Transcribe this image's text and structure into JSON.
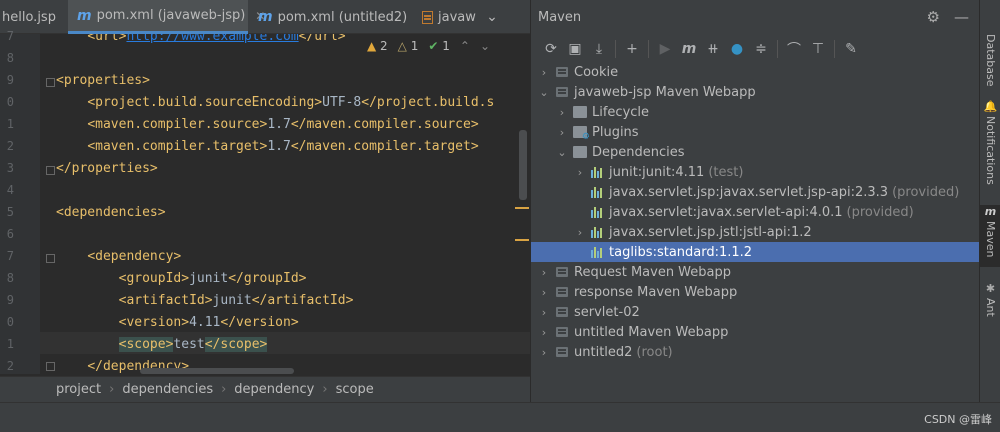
{
  "tabs": [
    {
      "label": "hello.jsp"
    },
    {
      "label": "pom.xml (javaweb-jsp)"
    },
    {
      "label": "pom.xml (untitled2)"
    },
    {
      "label": "javaw"
    }
  ],
  "tab_overflow": "⌄",
  "inspections": {
    "warnings": "2",
    "weak_warnings": "1",
    "ok": "1"
  },
  "gutter_lines": [
    "7",
    "8",
    "9",
    "0",
    "1",
    "2",
    "3",
    "4",
    "5",
    "6",
    "7",
    "8",
    "9",
    "0",
    "1",
    "2"
  ],
  "code_lines": [
    {
      "indent": "    ",
      "parts": [
        [
          "tg",
          "<url>"
        ],
        [
          "url",
          "http://www.example.com"
        ],
        [
          "tg",
          "</url>"
        ]
      ]
    },
    {
      "indent": "",
      "parts": []
    },
    {
      "indent": "",
      "parts": [
        [
          "tg",
          "<properties>"
        ]
      ]
    },
    {
      "indent": "    ",
      "parts": [
        [
          "tg",
          "<project.build.sourceEncoding>"
        ],
        [
          "tx",
          "UTF-8"
        ],
        [
          "tg",
          "</project.build.s"
        ]
      ]
    },
    {
      "indent": "    ",
      "parts": [
        [
          "tg",
          "<maven.compiler.source>"
        ],
        [
          "tx",
          "1.7"
        ],
        [
          "tg",
          "</maven.compiler.source>"
        ]
      ]
    },
    {
      "indent": "    ",
      "parts": [
        [
          "tg",
          "<maven.compiler.target>"
        ],
        [
          "tx",
          "1.7"
        ],
        [
          "tg",
          "</maven.compiler.target>"
        ]
      ]
    },
    {
      "indent": "",
      "parts": [
        [
          "tg",
          "</properties>"
        ]
      ]
    },
    {
      "indent": "",
      "parts": []
    },
    {
      "indent": "",
      "parts": [
        [
          "tg",
          "<dependencies>"
        ]
      ]
    },
    {
      "indent": "",
      "parts": []
    },
    {
      "indent": "    ",
      "parts": [
        [
          "tg",
          "<dependency>"
        ]
      ]
    },
    {
      "indent": "        ",
      "parts": [
        [
          "tg",
          "<groupId>"
        ],
        [
          "tx",
          "junit"
        ],
        [
          "tg",
          "</groupId>"
        ]
      ]
    },
    {
      "indent": "        ",
      "parts": [
        [
          "tg",
          "<artifactId>"
        ],
        [
          "tx",
          "junit"
        ],
        [
          "tg",
          "</artifactId>"
        ]
      ]
    },
    {
      "indent": "        ",
      "parts": [
        [
          "tg",
          "<version>"
        ],
        [
          "tx",
          "4.11"
        ],
        [
          "tg",
          "</version>"
        ]
      ]
    },
    {
      "indent": "        ",
      "parts": [
        [
          "hl",
          "<scope>"
        ],
        [
          "tx",
          "test"
        ],
        [
          "hl",
          "</scope>"
        ]
      ]
    },
    {
      "indent": "    ",
      "parts": [
        [
          "tg",
          "</dependency>"
        ]
      ]
    }
  ],
  "breadcrumb": [
    "project",
    "dependencies",
    "dependency",
    "scope"
  ],
  "maven": {
    "title": "Maven",
    "tree": [
      {
        "level": 0,
        "chev": "›",
        "icon": "maven-module-icon",
        "label": "Cookie",
        "note": ""
      },
      {
        "level": 0,
        "chev": "⌄",
        "icon": "maven-module-icon",
        "label": "javaweb-jsp Maven Webapp",
        "note": ""
      },
      {
        "level": 1,
        "chev": "›",
        "icon": "lifecycle-folder-icon",
        "label": "Lifecycle",
        "note": ""
      },
      {
        "level": 1,
        "chev": "›",
        "icon": "plugins-folder-icon",
        "label": "Plugins",
        "note": ""
      },
      {
        "level": 1,
        "chev": "⌄",
        "icon": "dependencies-folder-icon",
        "label": "Dependencies",
        "note": ""
      },
      {
        "level": 2,
        "chev": "›",
        "icon": "dependency-icon",
        "label": "junit:junit:4.11",
        "note": "(test)"
      },
      {
        "level": 2,
        "chev": "",
        "icon": "dependency-icon",
        "label": "javax.servlet.jsp:javax.servlet.jsp-api:2.3.3",
        "note": "(provided)"
      },
      {
        "level": 2,
        "chev": "",
        "icon": "dependency-icon",
        "label": "javax.servlet:javax.servlet-api:4.0.1",
        "note": "(provided)"
      },
      {
        "level": 2,
        "chev": "›",
        "icon": "dependency-icon",
        "label": "javax.servlet.jsp.jstl:jstl-api:1.2",
        "note": ""
      },
      {
        "level": 2,
        "chev": "",
        "icon": "dependency-icon",
        "label": "taglibs:standard:1.1.2",
        "note": "",
        "selected": true
      },
      {
        "level": 0,
        "chev": "›",
        "icon": "maven-module-icon",
        "label": "Request Maven Webapp",
        "note": ""
      },
      {
        "level": 0,
        "chev": "›",
        "icon": "maven-module-icon",
        "label": "response Maven Webapp",
        "note": ""
      },
      {
        "level": 0,
        "chev": "›",
        "icon": "maven-module-icon",
        "label": "servlet-02",
        "note": ""
      },
      {
        "level": 0,
        "chev": "›",
        "icon": "maven-module-icon",
        "label": "untitled Maven Webapp",
        "note": ""
      },
      {
        "level": 0,
        "chev": "›",
        "icon": "maven-module-icon",
        "label": "untitled2",
        "note": "(root)"
      }
    ]
  },
  "right_strip": [
    {
      "label": "Database",
      "icon": "database-icon"
    },
    {
      "label": "Notifications",
      "icon": "bell-icon"
    },
    {
      "label": "Maven",
      "icon": "maven-icon",
      "active": true
    },
    {
      "label": "Ant",
      "icon": "ant-icon"
    }
  ],
  "watermark": "CSDN @雷峰",
  "colors": {
    "accent": "#4b6eaf",
    "tag": "#e8bf6a",
    "text": "#a9b7c6",
    "maven_m": "#5ea3ea"
  }
}
